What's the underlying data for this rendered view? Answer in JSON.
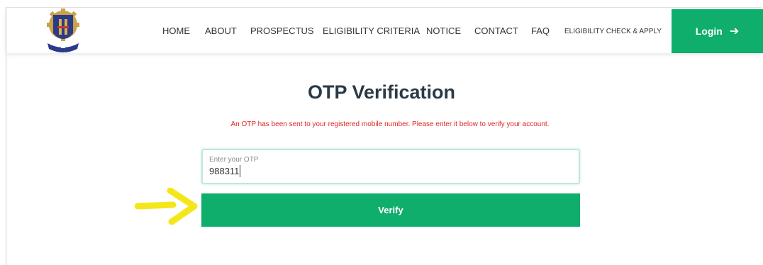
{
  "nav": {
    "items": [
      {
        "label": "HOME"
      },
      {
        "label": "ABOUT"
      },
      {
        "label": "PROSPECTUS"
      },
      {
        "label": "ELIGIBILITY CRITERIA"
      },
      {
        "label": "NOTICE"
      },
      {
        "label": "CONTACT"
      },
      {
        "label": "FAQ"
      },
      {
        "label": "ELIGIBILITY CHECK & APPLY"
      }
    ],
    "login_label": "Login",
    "login_icon": "arrow-right-icon"
  },
  "main": {
    "title": "OTP Verification",
    "message": "An OTP has been sent to your registered mobile number. Please enter it below to verify your account.",
    "otp_label": "Enter your OTP",
    "otp_value": "988311",
    "verify_label": "Verify"
  },
  "colors": {
    "accent": "#0fae6c",
    "message": "#e32424",
    "annotation_arrow": "#f5e61a"
  }
}
